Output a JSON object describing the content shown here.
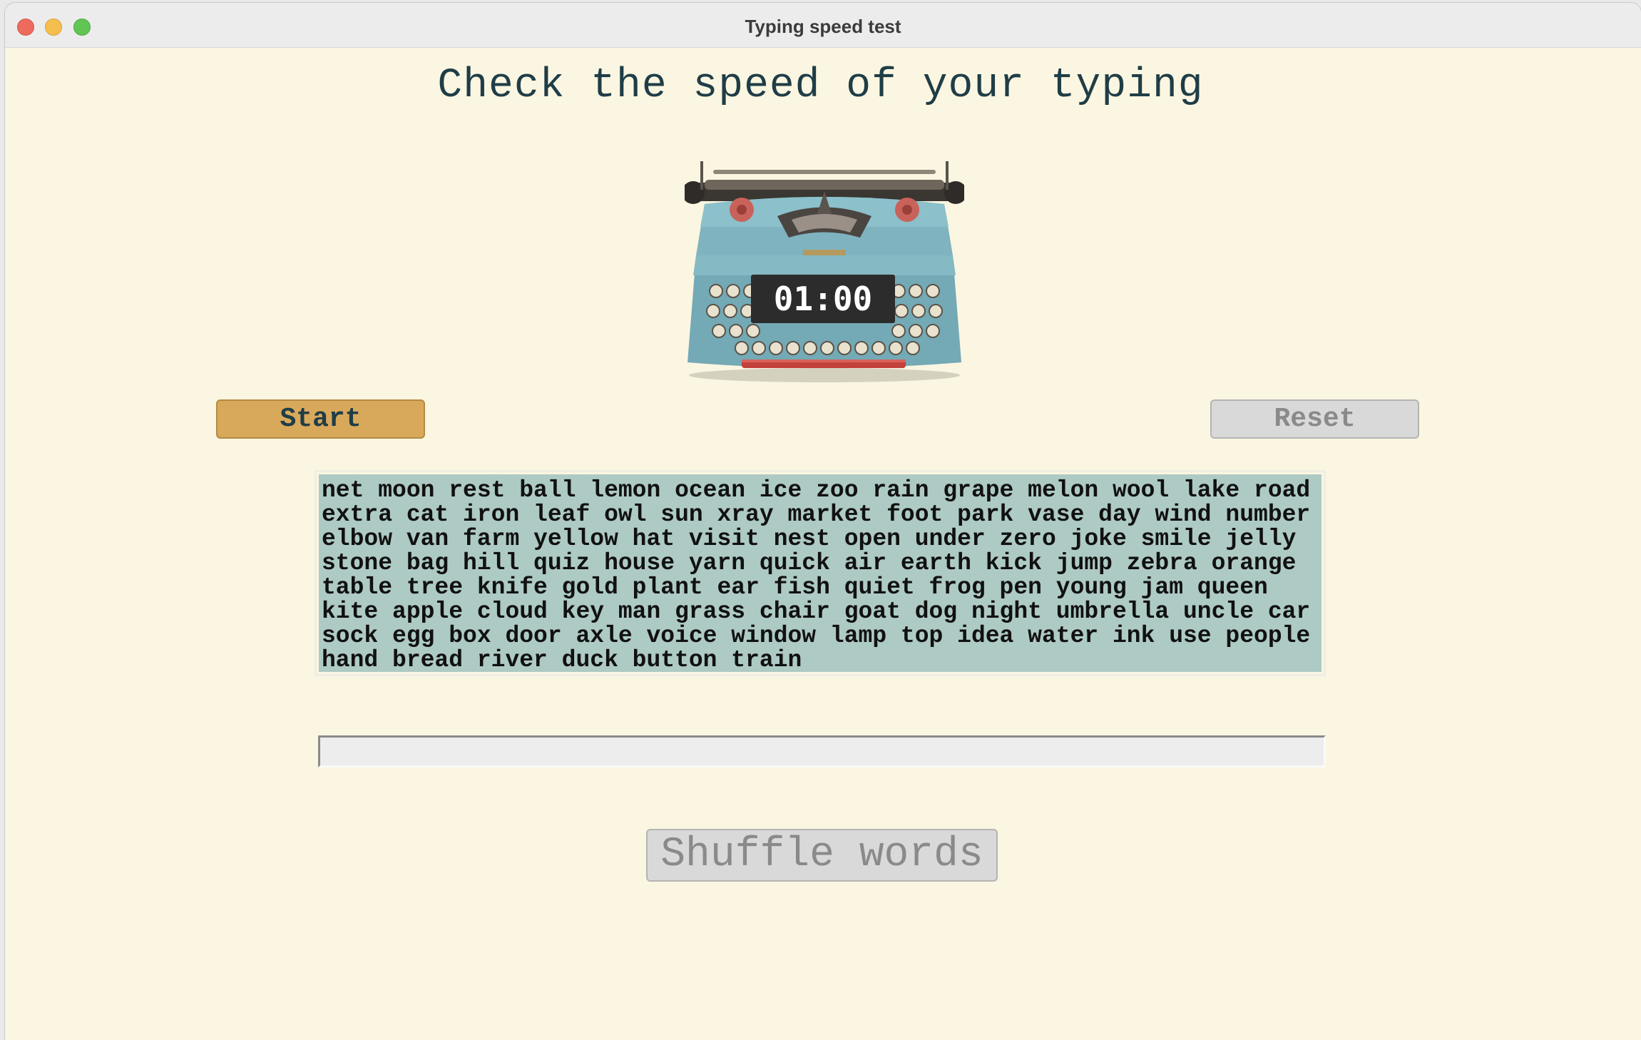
{
  "window": {
    "title": "Typing speed test"
  },
  "heading": "Check the speed of your typing",
  "timer": "01:00",
  "buttons": {
    "start": "Start",
    "reset": "Reset",
    "shuffle": "Shuffle words"
  },
  "words_text": "net moon rest ball lemon ocean ice zoo rain grape melon wool lake road\nextra cat iron leaf owl sun xray market foot park vase day wind number\nelbow van farm yellow hat visit nest open under zero joke smile jelly\nstone bag hill quiz house yarn quick air earth kick jump zebra orange\ntable tree knife gold plant ear fish quiet frog pen young jam queen\nkite apple cloud key man grass chair goat dog night umbrella uncle car\nsock egg box door axle voice window lamp top idea water ink use people\nhand bread river duck button train",
  "input": {
    "value": ""
  },
  "colors": {
    "background": "#fbf6e1",
    "heading": "#1f3d47",
    "start_button": "#d9a95b",
    "disabled_button": "#d9d9d9",
    "words_background": "#aecac4",
    "timer_background": "#2c2c2c"
  },
  "icons": {
    "typewriter": "typewriter-image"
  }
}
